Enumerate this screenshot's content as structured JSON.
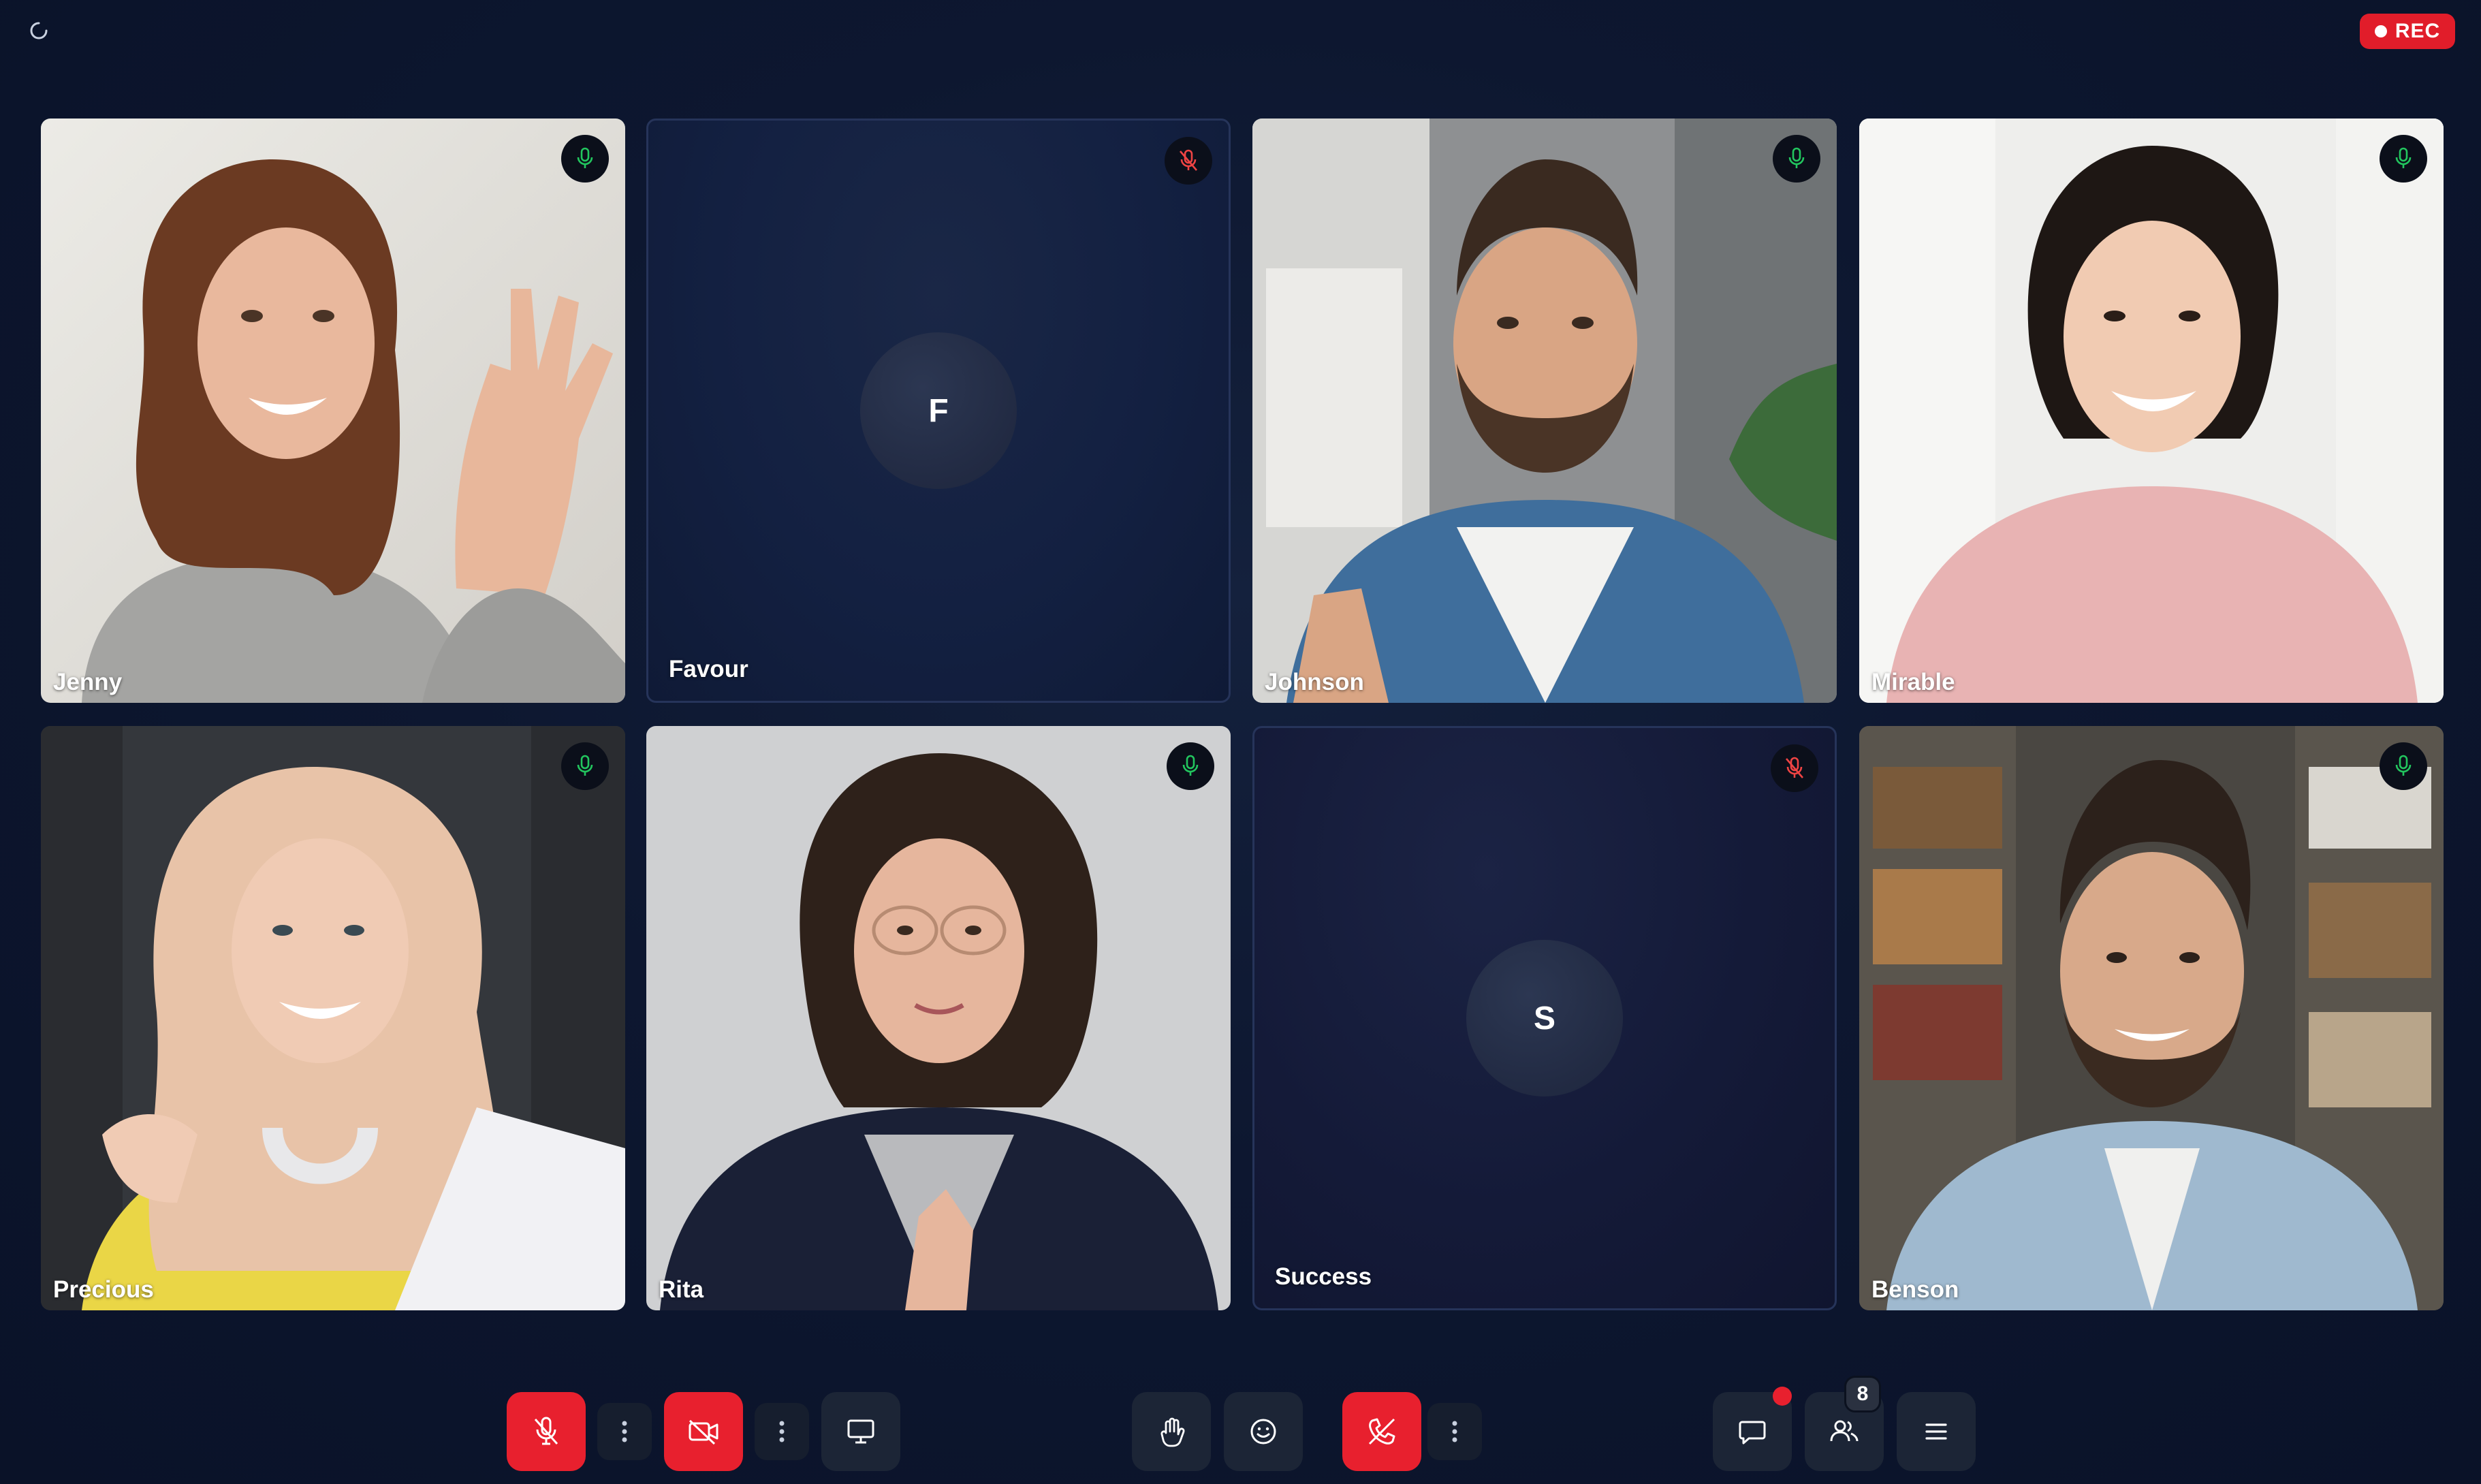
{
  "topbar": {
    "status_icon": "loading-spinner-icon",
    "recording_label": "REC"
  },
  "participants": [
    {
      "name": "Jenny",
      "video": true,
      "mic": "on"
    },
    {
      "name": "Favour",
      "video": false,
      "initial": "F",
      "mic": "muted"
    },
    {
      "name": "Johnson",
      "video": true,
      "mic": "on"
    },
    {
      "name": "Mirable",
      "video": true,
      "mic": "on"
    },
    {
      "name": "Precious",
      "video": true,
      "mic": "on"
    },
    {
      "name": "Rita",
      "video": true,
      "mic": "on"
    },
    {
      "name": "Success",
      "video": false,
      "initial": "S",
      "mic": "muted"
    },
    {
      "name": "Benson",
      "video": true,
      "mic": "on"
    }
  ],
  "controls": {
    "left": [
      {
        "icon": "mic-off-icon",
        "state": "muted"
      },
      {
        "icon": "more-vertical-icon"
      },
      {
        "icon": "video-off-icon",
        "state": "off"
      },
      {
        "icon": "more-vertical-icon"
      },
      {
        "icon": "screen-share-icon"
      }
    ],
    "center": [
      {
        "icon": "raise-hand-icon"
      },
      {
        "icon": "emoji-icon"
      },
      {
        "icon": "end-call-icon"
      },
      {
        "icon": "more-vertical-icon"
      }
    ],
    "right": [
      {
        "icon": "chat-icon",
        "has_notification": true
      },
      {
        "icon": "participants-icon",
        "count": "8"
      },
      {
        "icon": "menu-icon"
      }
    ]
  },
  "colors": {
    "background": "#0d1730",
    "accent_red": "#e8202e",
    "mic_on": "#22c55e",
    "mic_muted": "#ef4444",
    "control_bg": "#1c2536"
  }
}
